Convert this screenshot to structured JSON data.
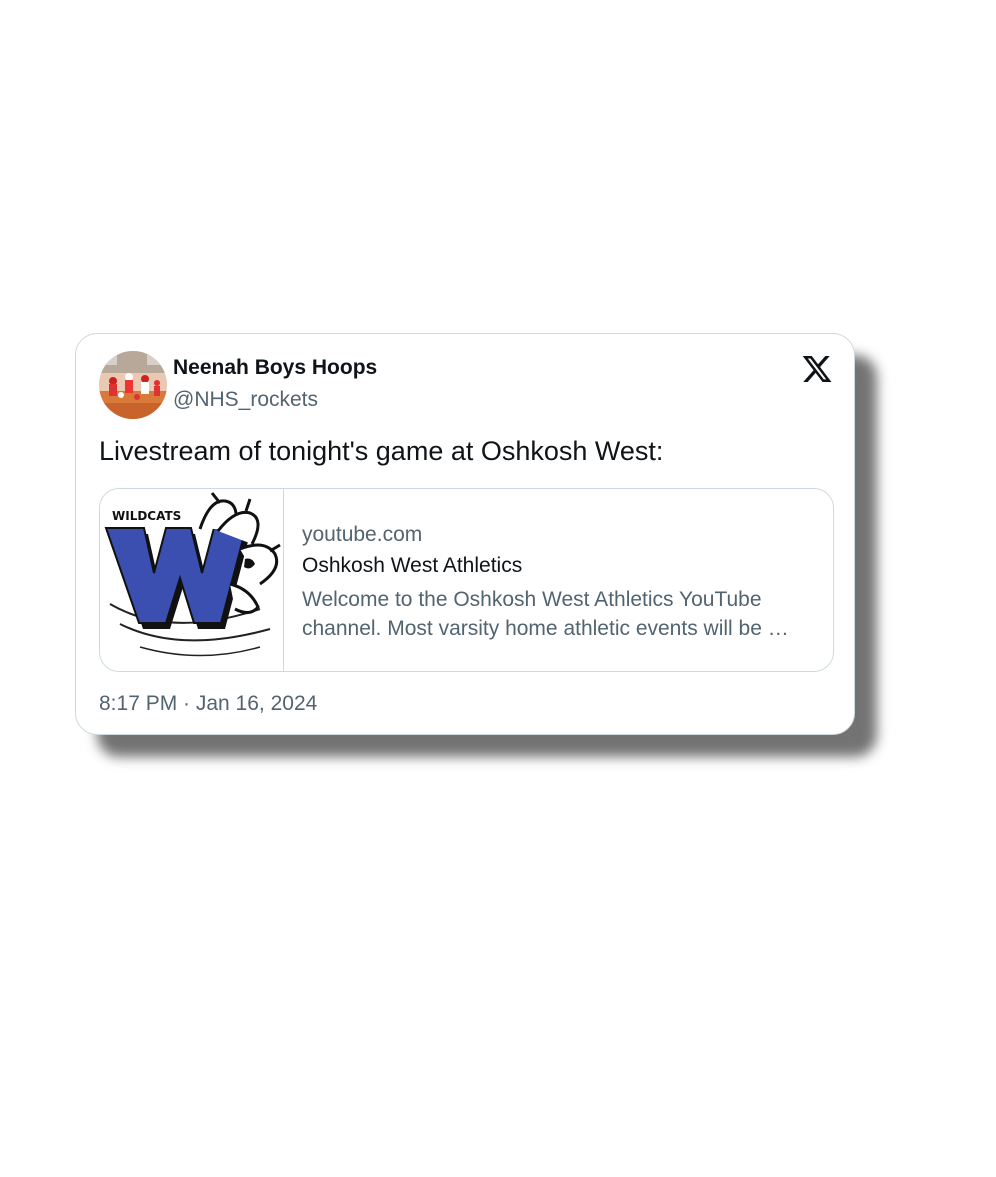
{
  "tweet": {
    "author": {
      "name": "Neenah Boys Hoops",
      "handle": "@NHS_rockets",
      "avatar_icon": "basketball-team-photo"
    },
    "text": "Livestream of tonight's game at Oshkosh West:",
    "link_card": {
      "thumbnail_icon": "wildcats-w-claw-logo",
      "thumbnail_logo_text": "WILDCATS",
      "domain": "youtube.com",
      "title": "Oshkosh West Athletics",
      "description_line1": "Welcome to the Oshkosh West Athletics YouTube",
      "description_line2": "channel. Most varsity home athletic events will be …"
    },
    "timestamp": "8:17 PM · Jan 16, 2024"
  },
  "brand": {
    "platform_icon": "x-logo-icon",
    "colors": {
      "text_primary": "#0f1419",
      "text_secondary": "#536471",
      "border": "#cfd9de",
      "logo_blue": "#3a4fb0"
    }
  }
}
